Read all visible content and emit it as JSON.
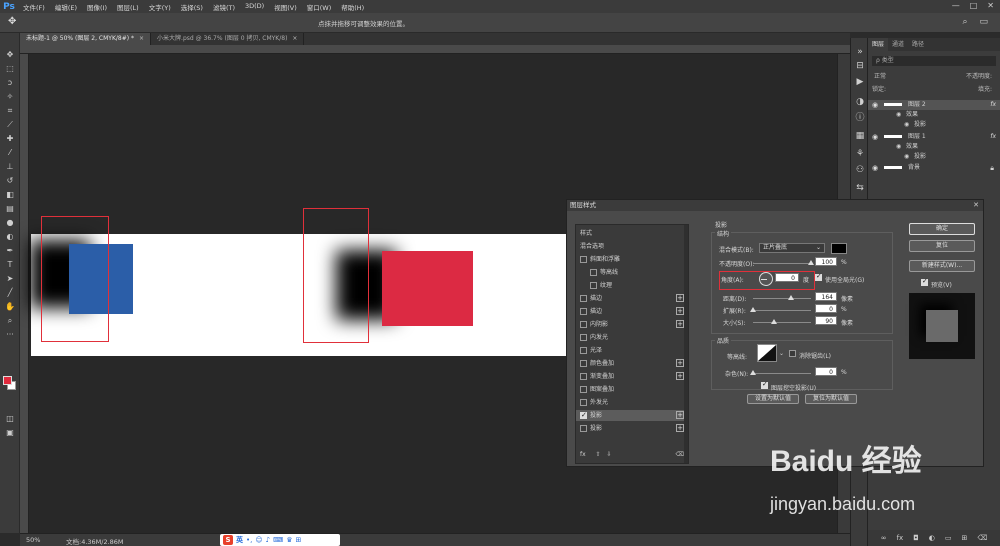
{
  "menubar": {
    "logo": "Ps",
    "items": [
      "文件(F)",
      "编辑(E)",
      "图像(I)",
      "图层(L)",
      "文字(Y)",
      "选择(S)",
      "滤镜(T)",
      "3D(D)",
      "视图(V)",
      "窗口(W)",
      "帮助(H)"
    ],
    "window_controls": [
      "—",
      "□",
      "✕"
    ]
  },
  "optionsbar": {
    "hint": "点抹并拖移可调整效果的位置。"
  },
  "tabs": [
    {
      "label": "未标题-1 @ 50% (图层 2, CMYK/8#) *",
      "active": true
    },
    {
      "label": "小米大牌.psd @ 36.7% (图层 0 拷贝, CMYK/8)",
      "active": false
    }
  ],
  "statusbar": {
    "zoom": "50%",
    "doc_size": "文档:4.36M/2.86M",
    "ime_logo": "S",
    "ime_lang": "英"
  },
  "layers_panel": {
    "tabs": [
      "图层",
      "通道",
      "路径"
    ],
    "filter_label": "ρ 类型",
    "blend_mode": "正常",
    "opacity_label": "不透明度:",
    "lock_label": "锁定:",
    "fill_label": "填充:",
    "rows": [
      {
        "label": "图层 2",
        "kind": "layer",
        "fx": "fx",
        "selected": true
      },
      {
        "label": "效果",
        "kind": "effect-group"
      },
      {
        "label": "投影",
        "kind": "effect"
      },
      {
        "label": "图层 1",
        "kind": "layer",
        "fx": "fx",
        "selected": false
      },
      {
        "label": "效果",
        "kind": "effect-group"
      },
      {
        "label": "投影",
        "kind": "effect"
      },
      {
        "label": "背景",
        "kind": "background"
      }
    ]
  },
  "dialog": {
    "title": "图层样式",
    "style_list": [
      {
        "label": "样式",
        "checkbox": false,
        "indent": false,
        "plus": false
      },
      {
        "label": "混合选项",
        "checkbox": false,
        "indent": false,
        "plus": false
      },
      {
        "label": "斜面和浮雕",
        "checkbox": true,
        "checked": false,
        "indent": false,
        "plus": false
      },
      {
        "label": "等高线",
        "checkbox": true,
        "checked": false,
        "indent": true,
        "plus": false
      },
      {
        "label": "纹理",
        "checkbox": true,
        "checked": false,
        "indent": true,
        "plus": false
      },
      {
        "label": "描边",
        "checkbox": true,
        "checked": false,
        "indent": false,
        "plus": true
      },
      {
        "label": "描边",
        "checkbox": true,
        "checked": false,
        "indent": false,
        "plus": true
      },
      {
        "label": "内阴影",
        "checkbox": true,
        "checked": false,
        "indent": false,
        "plus": true
      },
      {
        "label": "内发光",
        "checkbox": true,
        "checked": false,
        "indent": false,
        "plus": false
      },
      {
        "label": "光泽",
        "checkbox": true,
        "checked": false,
        "indent": false,
        "plus": false
      },
      {
        "label": "颜色叠加",
        "checkbox": true,
        "checked": false,
        "indent": false,
        "plus": true
      },
      {
        "label": "渐变叠加",
        "checkbox": true,
        "checked": false,
        "indent": false,
        "plus": true
      },
      {
        "label": "图案叠加",
        "checkbox": true,
        "checked": false,
        "indent": false,
        "plus": false
      },
      {
        "label": "外发光",
        "checkbox": true,
        "checked": false,
        "indent": false,
        "plus": false
      },
      {
        "label": "投影",
        "checkbox": true,
        "checked": true,
        "indent": false,
        "plus": true,
        "selected": true
      },
      {
        "label": "投影",
        "checkbox": true,
        "checked": false,
        "indent": false,
        "plus": true
      }
    ],
    "list_footer": "fx",
    "drop_shadow": {
      "section_title": "投影",
      "structure_title": "结构",
      "blend_mode_label": "混合模式(B):",
      "blend_mode_value": "正片叠底",
      "shadow_color": "#000000",
      "opacity_label": "不透明度(O):",
      "opacity_value": "100",
      "opacity_unit": "%",
      "opacity_level": 1.0,
      "angle_label": "角度(A):",
      "angle_value": "0",
      "angle_unit": "度",
      "global_light_label": "使用全局光(G)",
      "global_light_checked": true,
      "distance_label": "距离(D):",
      "distance_value": "164",
      "distance_unit": "像素",
      "distance_level": 0.66,
      "spread_label": "扩展(R):",
      "spread_value": "0",
      "spread_unit": "%",
      "spread_level": 0.0,
      "size_label": "大小(S):",
      "size_value": "90",
      "size_unit": "像素",
      "size_level": 0.36,
      "quality_title": "品质",
      "contour_label": "等高线:",
      "antialias_label": "消除锯齿(L)",
      "noise_label": "杂色(N):",
      "noise_value": "0",
      "noise_unit": "%",
      "noise_level": 0.0,
      "knockout_label": "图层挖空投影(U)",
      "knockout_checked": true,
      "set_default": "设置为默认值",
      "reset_default": "复位为默认值"
    },
    "buttons": {
      "ok": "确定",
      "reset": "复位",
      "new_style": "新建样式(W)...",
      "preview_label": "预览(V)",
      "preview_checked": true
    }
  },
  "canvas": {
    "blue_color": "#2b5ea8",
    "red_color": "#dc2a43",
    "marker_color": "#e0303a"
  },
  "watermark": {
    "logo": "Baidu 经验",
    "url": "jingyan.baidu.com"
  }
}
